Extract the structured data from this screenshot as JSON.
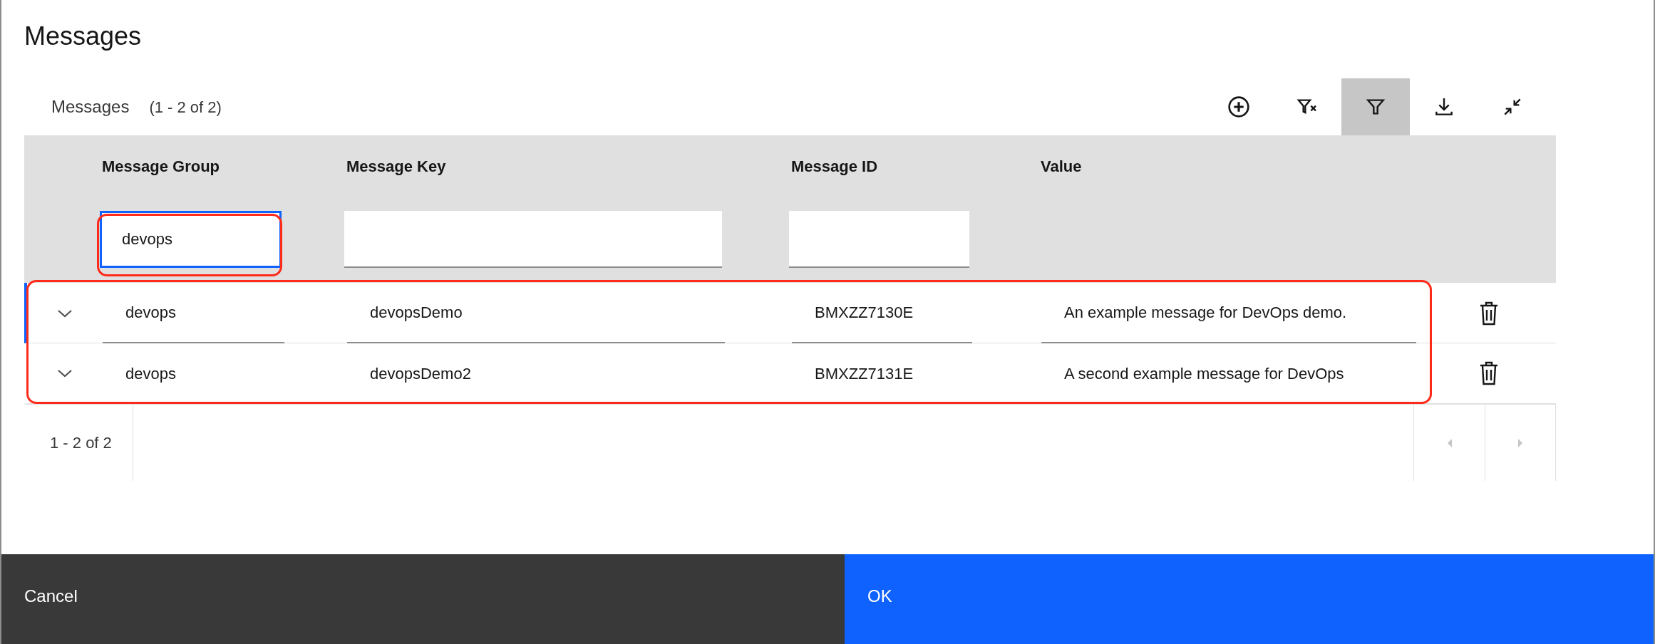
{
  "dialog": {
    "title": "Messages"
  },
  "toolbar": {
    "label": "Messages",
    "count": "(1 - 2 of 2)",
    "buttons": [
      {
        "kind": "add",
        "selected": false
      },
      {
        "kind": "clear-filter",
        "selected": false
      },
      {
        "kind": "filter",
        "selected": true
      },
      {
        "kind": "download",
        "selected": false
      },
      {
        "kind": "collapse",
        "selected": false
      }
    ]
  },
  "table": {
    "columns": [
      "Message Group",
      "Message Key",
      "Message ID",
      "Value"
    ],
    "filters": [
      {
        "value": "devops",
        "focused": true
      },
      {
        "focused": false
      },
      {
        "focused": false
      }
    ],
    "rows": [
      {
        "cells": [
          "devops",
          "devopsDemo",
          "BMXZZ7130E",
          "An example message for DevOps demo."
        ],
        "editing": true
      },
      {
        "cells": [
          "devops",
          "devopsDemo2",
          "BMXZZ7131E",
          "A second example message for DevOps"
        ],
        "editing": false
      }
    ]
  },
  "pagination": {
    "range": "1 - 2 of 2"
  },
  "footer": {
    "buttons": [
      {
        "label": "Cancel",
        "kind": "secondary"
      },
      {
        "label": "OK",
        "kind": "primary"
      }
    ]
  }
}
